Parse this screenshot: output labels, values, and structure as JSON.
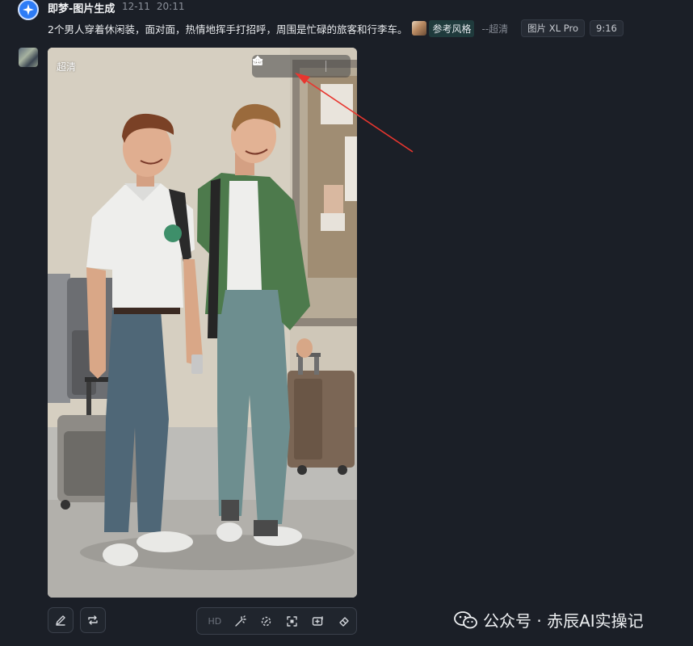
{
  "header": {
    "app_name": "即梦-图片生成",
    "date": "12-11",
    "time": "20:11",
    "prompt": "2个男人穿着休闲装，面对面，热情地挥手打招呼，周围是忙碌的旅客和行李车。",
    "reference_label": "参考风格",
    "quality_suffix": "--超清",
    "model_tag": "图片 XL Pro",
    "ratio_tag": "9:16"
  },
  "image": {
    "quality_badge": "超清",
    "toolbar": [
      "share-icon",
      "download-icon",
      "more-icon",
      "star-icon"
    ]
  },
  "bottom_actions": {
    "hd_label": "HD",
    "tools": [
      "magic-wand-icon",
      "inpaint-icon",
      "expand-icon",
      "add-image-icon",
      "eraser-icon"
    ]
  },
  "watermark": {
    "text": "公众号 · 赤辰AI实操记"
  },
  "colors": {
    "background": "#1b1f27",
    "accent": "#2e7cf6",
    "arrow": "#e8362f"
  }
}
